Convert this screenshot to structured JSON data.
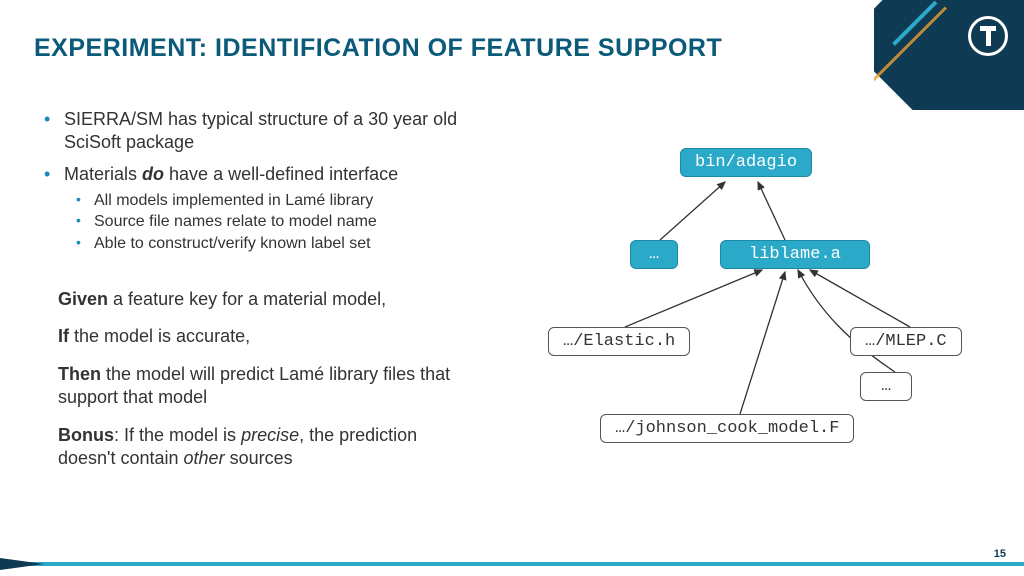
{
  "title": "EXPERIMENT: IDENTIFICATION OF FEATURE SUPPORT",
  "bullets": {
    "item0": "SIERRA/SM has typical structure of a 30 year old SciSoft package",
    "item1_pre": "Materials ",
    "item1_em": "do",
    "item1_post": " have a well-defined interface",
    "sub0": "All models implemented in Lamé library",
    "sub1": "Source file names relate to model name",
    "sub2": "Able to construct/verify known label set"
  },
  "paras": {
    "p0_b": "Given",
    "p0_r": " a feature key for a material model,",
    "p1_b": "If",
    "p1_r": " the model is accurate,",
    "p2_b": "Then",
    "p2_r": " the model will predict Lamé library files that support that model",
    "p3_b": "Bonus",
    "p3_r1": ": If the model is ",
    "p3_i": "precise",
    "p3_r2": ", the prediction doesn't contain ",
    "p3_i2": "other",
    "p3_r3": " sources"
  },
  "diagram": {
    "n_top": "bin/adagio",
    "n_dots": "…",
    "n_lib": "liblame.a",
    "n_elastic": "…/Elastic.h",
    "n_mlep": "…/MLEP.C",
    "n_dots2": "…",
    "n_jc": "…/johnson_cook_model.F"
  },
  "page": "15"
}
